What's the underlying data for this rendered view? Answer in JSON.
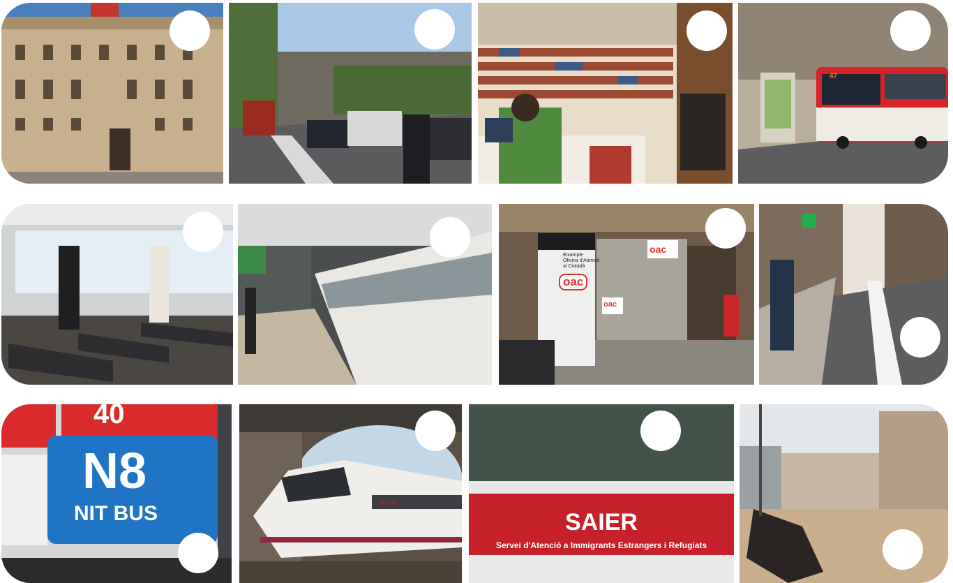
{
  "photos": {
    "nitbus": {
      "route_top": "40",
      "route": "N8",
      "label": "NIT BUS"
    },
    "oac_office": {
      "logo": "oac",
      "panel_lines": [
        "Eixample",
        "Oficina d'Atenció",
        "al Ciutadà"
      ]
    },
    "train": {
      "brand": "renfe"
    },
    "bus": {
      "number": "47"
    },
    "saier": {
      "title": "SAIER",
      "subtitle": "Servei d'Atenció a Immigrants Estrangers i Refugiats"
    }
  },
  "colors": {
    "bus_red": "#d6232a",
    "nitbus_blue": "#1f74c4",
    "saier_red": "#c6202a",
    "oac_red": "#e0312b"
  }
}
